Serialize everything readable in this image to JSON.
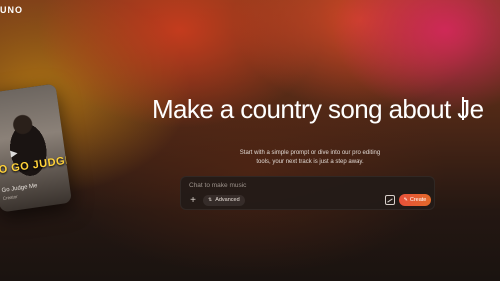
{
  "brand": {
    "logo_text": "UNO"
  },
  "featured_card": {
    "headline": "O GO JUDGE ME",
    "song_title": "Go Judge Me",
    "artist": "Creator",
    "play_icon": "play-icon"
  },
  "hero": {
    "typed_prompt": "Make a country song about Je",
    "subtitle_line1": "Start with a simple prompt or dive into our pro editing",
    "subtitle_line2": "tools, your next track is just a step away."
  },
  "composer": {
    "placeholder": "Chat to make music",
    "plus_icon": "plus-icon",
    "advanced_label": "Advanced",
    "advanced_icon": "sliders-icon",
    "image_icon": "image-icon",
    "create_label": "Create",
    "create_icon": "pencil-icon"
  },
  "colors": {
    "accent": "#E8503A",
    "background_dark": "#1C1411"
  }
}
